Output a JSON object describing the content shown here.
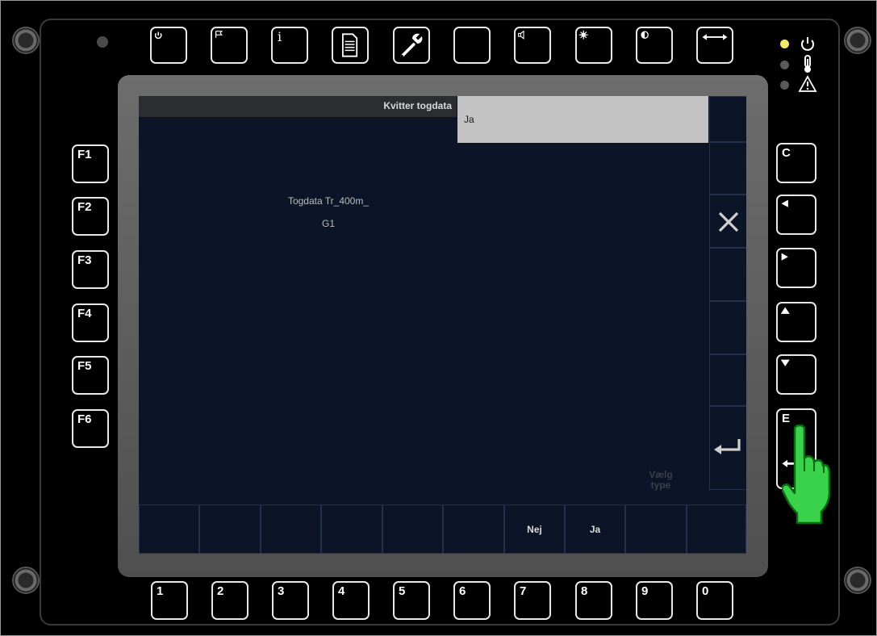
{
  "window": {
    "title": "Kvitter togdata"
  },
  "input": {
    "value": "Ja"
  },
  "info": {
    "line1": "Togdata Tr_400m_",
    "line2": "G1"
  },
  "hint": {
    "line1": "Vælg",
    "line2": "type"
  },
  "top_keys": [
    {
      "icon": "power-icon"
    },
    {
      "icon": "flag-icon"
    },
    {
      "icon": "info-icon",
      "label": "i"
    },
    {
      "icon": "document-icon"
    },
    {
      "icon": "wrench-icon"
    },
    {
      "icon": "blank-icon"
    },
    {
      "icon": "speaker-icon"
    },
    {
      "icon": "brightness-icon"
    },
    {
      "icon": "contrast-icon"
    },
    {
      "icon": "swap-horizontal-icon"
    }
  ],
  "function_keys": [
    "F1",
    "F2",
    "F3",
    "F4",
    "F5",
    "F6"
  ],
  "right_keys": [
    {
      "label": "C",
      "icon": ""
    },
    {
      "label": "",
      "icon": "arrow-left-icon"
    },
    {
      "label": "",
      "icon": "arrow-right-icon"
    },
    {
      "label": "",
      "icon": "arrow-up-icon"
    },
    {
      "label": "",
      "icon": "arrow-down-icon"
    },
    {
      "label": "E",
      "icon": "enter-icon"
    }
  ],
  "number_keys": [
    "1",
    "2",
    "3",
    "4",
    "5",
    "6",
    "7",
    "8",
    "9",
    "0"
  ],
  "status_leds": [
    {
      "icon": "power-icon",
      "color": "#f2ea6a"
    },
    {
      "icon": "thermometer-icon",
      "color": "#5a5a5a"
    },
    {
      "icon": "warning-icon",
      "color": "#5a5a5a"
    }
  ],
  "side_buttons": [
    {
      "name": "side-button-1",
      "icon": ""
    },
    {
      "name": "side-button-2",
      "icon": ""
    },
    {
      "name": "close-button",
      "icon": "close-icon"
    },
    {
      "name": "side-button-4",
      "icon": ""
    },
    {
      "name": "side-button-5",
      "icon": ""
    },
    {
      "name": "side-button-6",
      "icon": ""
    },
    {
      "name": "enter-button",
      "icon": "enter-icon"
    }
  ],
  "bottom_buttons": [
    "",
    "",
    "",
    "",
    "",
    "",
    "Nej",
    "Ja",
    "",
    ""
  ],
  "colors": {
    "screen_bg": "#0b1527",
    "input_bg": "#c3c3c3",
    "led_on": "#f2ea6a",
    "pointer_hand": "#39d24a"
  }
}
